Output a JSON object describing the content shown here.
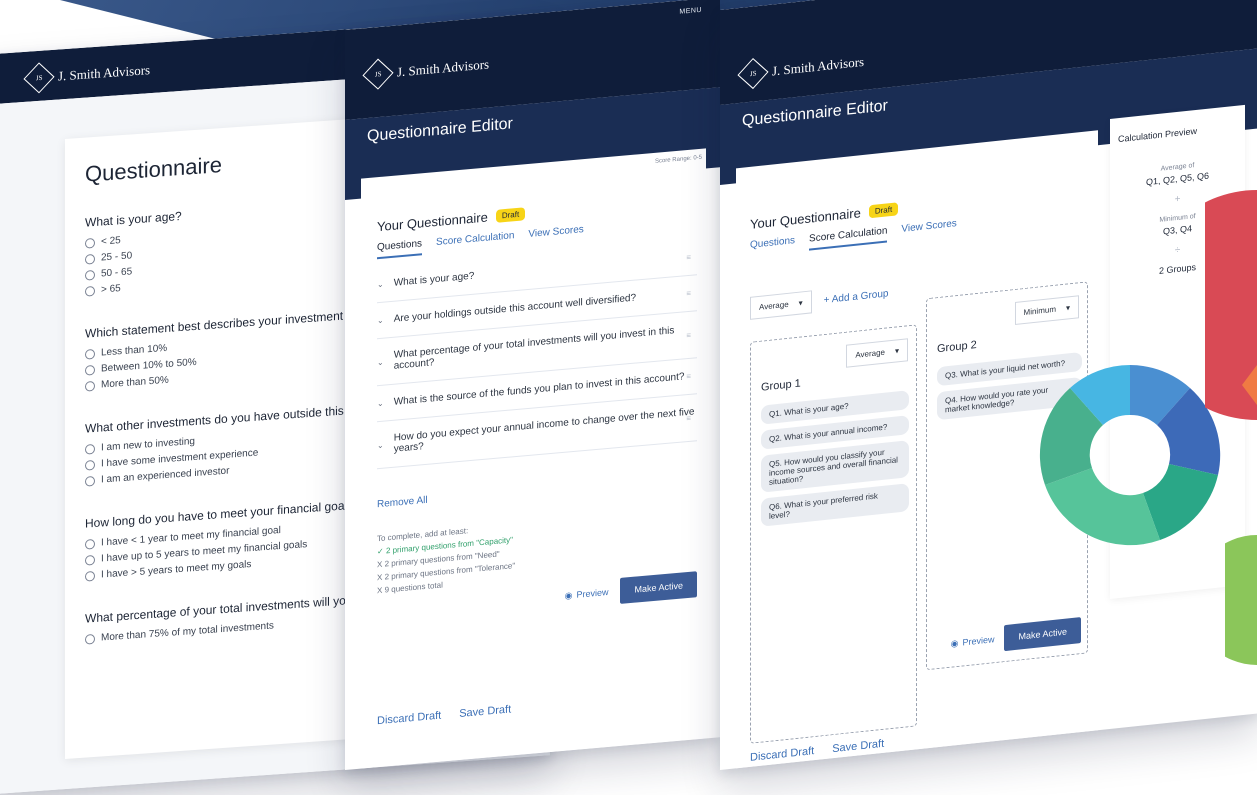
{
  "brand": {
    "name": "J. Smith Advisors",
    "mark": "JS"
  },
  "menu_label": "MENU",
  "screen1": {
    "title": "Questionnaire",
    "questions": [
      {
        "text": "What is your age?",
        "options": [
          "< 25",
          "25 - 50",
          "50 - 65",
          "> 65"
        ]
      },
      {
        "text": "Which statement best describes your investment experience?",
        "options": [
          "Less than 10%",
          "Between 10% to 50%",
          "More than 50%"
        ]
      },
      {
        "text": "What other investments do you have outside this account?",
        "options": [
          "I am new to investing",
          "I have some investment experience",
          "I am an experienced investor"
        ]
      },
      {
        "text": "How long do you have to meet your financial goal for this account?",
        "options": [
          "I have < 1 year to meet my financial goal",
          "I have up to 5 years to meet my financial goals",
          "I have > 5 years to meet my goals"
        ]
      },
      {
        "text": "What percentage of your total investments will you invest in this account?",
        "options": [
          "More than 75% of my total investments"
        ]
      }
    ]
  },
  "screen2": {
    "editor_title": "Questionnaire Editor",
    "score_range": "Score Range: 0-5",
    "your_questionnaire": "Your Questionnaire",
    "draft": "Draft",
    "tabs": [
      "Questions",
      "Score Calculation",
      "View Scores"
    ],
    "questions": [
      "What is your age?",
      "Are your holdings outside this account well diversified?",
      "What percentage of your total investments will you invest in this account?",
      "What is the source of the funds you plan to invest in this account?",
      "How do you expect your annual income to change over the next five years?"
    ],
    "remove_all": "Remove All",
    "to_complete": "To complete, add at least:",
    "requirements": [
      {
        "text": "2 primary questions from \"Capacity\"",
        "done": true,
        "mark": "✓"
      },
      {
        "text": "2 primary questions from \"Need\"",
        "done": false,
        "mark": "X"
      },
      {
        "text": "2 primary questions from \"Tolerance\"",
        "done": false,
        "mark": "X"
      },
      {
        "text": "9 questions total",
        "done": false,
        "mark": "X"
      }
    ],
    "preview": "Preview",
    "make_active": "Make Active",
    "discard_draft": "Discard Draft",
    "save_draft": "Save Draft"
  },
  "screen3": {
    "editor_title": "Questionnaire Editor",
    "your_questionnaire": "Your Questionnaire",
    "draft": "Draft",
    "tabs": [
      "Questions",
      "Score Calculation",
      "View Scores"
    ],
    "aggregate_select": "Average",
    "add_group": "Add a Group",
    "group1": {
      "title": "Group 1",
      "select": "Average",
      "chips": [
        "Q1. What is your age?",
        "Q2. What is your annual income?",
        "Q5. How would you classify your income sources and overall financial situation?",
        "Q6. What is your preferred risk level?"
      ]
    },
    "group2": {
      "title": "Group 2",
      "select": "Minimum",
      "chips": [
        "Q3. What is your liquid net worth?",
        "Q4. How would you rate your market knowledge?"
      ]
    },
    "preview": "Preview",
    "make_active": "Make Active",
    "discard_draft": "Discard Draft",
    "save_draft": "Save Draft",
    "calc_preview": {
      "title": "Calculation Preview",
      "avg_label": "Average of",
      "avg_value": "Q1, Q2, Q5, Q6",
      "plus": "+",
      "min_label": "Minimum of",
      "min_value": "Q3, Q4",
      "divide": "÷",
      "groups": "2 Groups"
    }
  },
  "colors": {
    "navy": "#0f1d3a",
    "accent_blue": "#3b6fb6",
    "button_blue": "#3d5d98",
    "draft_yellow": "#f7d417",
    "success_green": "#2f9f6a"
  }
}
